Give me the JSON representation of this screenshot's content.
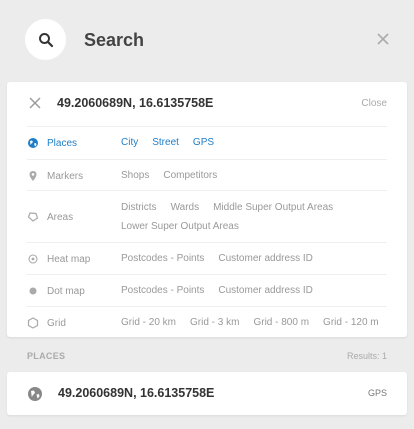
{
  "header": {
    "search_icon": "search-icon",
    "title": "Search",
    "close_icon": "close-icon"
  },
  "query": {
    "value": "49.2060689N, 16.6135758E",
    "close_label": "Close"
  },
  "rows": [
    {
      "label": "Places",
      "icon": "globe-icon",
      "active": true,
      "options": [
        "City",
        "Street",
        "GPS"
      ]
    },
    {
      "label": "Markers",
      "icon": "marker-icon",
      "active": false,
      "options": [
        "Shops",
        "Competitors"
      ]
    },
    {
      "label": "Areas",
      "icon": "polygon-icon",
      "active": false,
      "options": [
        "Districts",
        "Wards",
        "Middle Super Output Areas",
        "Lower Super Output Areas"
      ]
    },
    {
      "label": "Heat map",
      "icon": "target-icon",
      "active": false,
      "options": [
        "Postcodes - Points",
        "Customer address ID"
      ]
    },
    {
      "label": "Dot map",
      "icon": "dot-icon",
      "active": false,
      "options": [
        "Postcodes - Points",
        "Customer address ID"
      ]
    },
    {
      "label": "Grid",
      "icon": "hexagon-icon",
      "active": false,
      "options": [
        "Grid - 20 km",
        "Grid - 3 km",
        "Grid - 800 m",
        "Grid - 120 m"
      ]
    }
  ],
  "results": {
    "section_label": "PLACES",
    "count_label": "Results: 1",
    "items": [
      {
        "icon": "globe-icon",
        "value": "49.2060689N, 16.6135758E",
        "type": "GPS"
      }
    ]
  },
  "colors": {
    "accent": "#1e7ec8",
    "background": "#ececec",
    "card": "#ffffff"
  }
}
